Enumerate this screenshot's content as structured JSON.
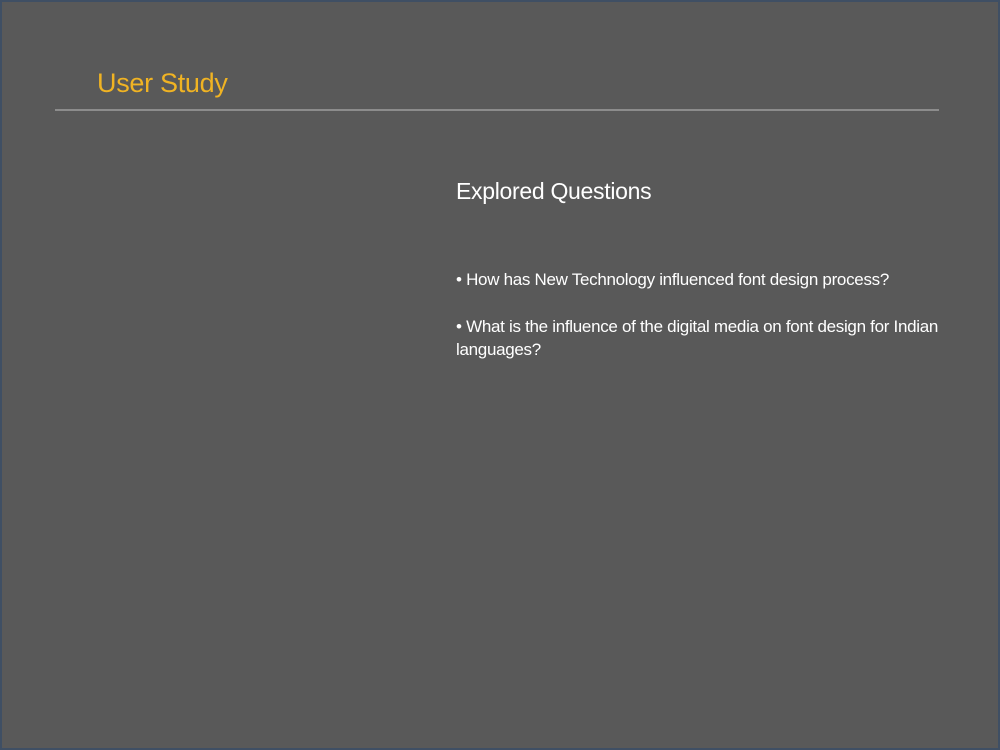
{
  "slide": {
    "title": "User Study",
    "subtitle": "Explored Questions",
    "bullets": [
      "• How has New Technology influenced font design process?",
      "• What is the influence of the digital media on font design for Indian languages?"
    ]
  },
  "colors": {
    "background": "#595959",
    "frame": "#3f4f64",
    "title": "#f0b323",
    "text": "#ffffff",
    "rule": "#8c8c8c"
  }
}
